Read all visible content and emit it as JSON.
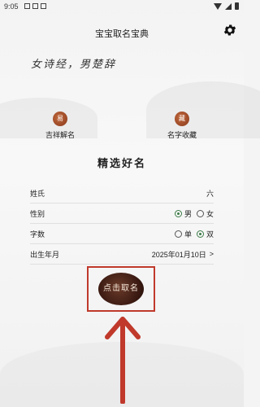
{
  "status": {
    "time": "9:05"
  },
  "header": {
    "title": "宝宝取名宝典",
    "settings_icon": "gear-icon"
  },
  "hero": {
    "text": "女诗经，男楚辞"
  },
  "features": [
    {
      "label": "吉祥解名",
      "icon_text": "易"
    },
    {
      "label": "名字收藏",
      "icon_text": "藏"
    }
  ],
  "section": {
    "title": "精选好名"
  },
  "form": {
    "surname_label": "姓氏",
    "surname_value": "六",
    "gender_label": "性别",
    "gender_male": "男",
    "gender_female": "女",
    "gender_selected": "男",
    "count_label": "字数",
    "count_single": "单",
    "count_double": "双",
    "count_selected": "双",
    "birth_label": "出生年月",
    "birth_value": "2025年01月10日",
    "birth_chevron": ">"
  },
  "action": {
    "button_text": "点击取名"
  },
  "annotation": {
    "arrow_color": "#c0392b",
    "box_color": "#c0392b"
  }
}
